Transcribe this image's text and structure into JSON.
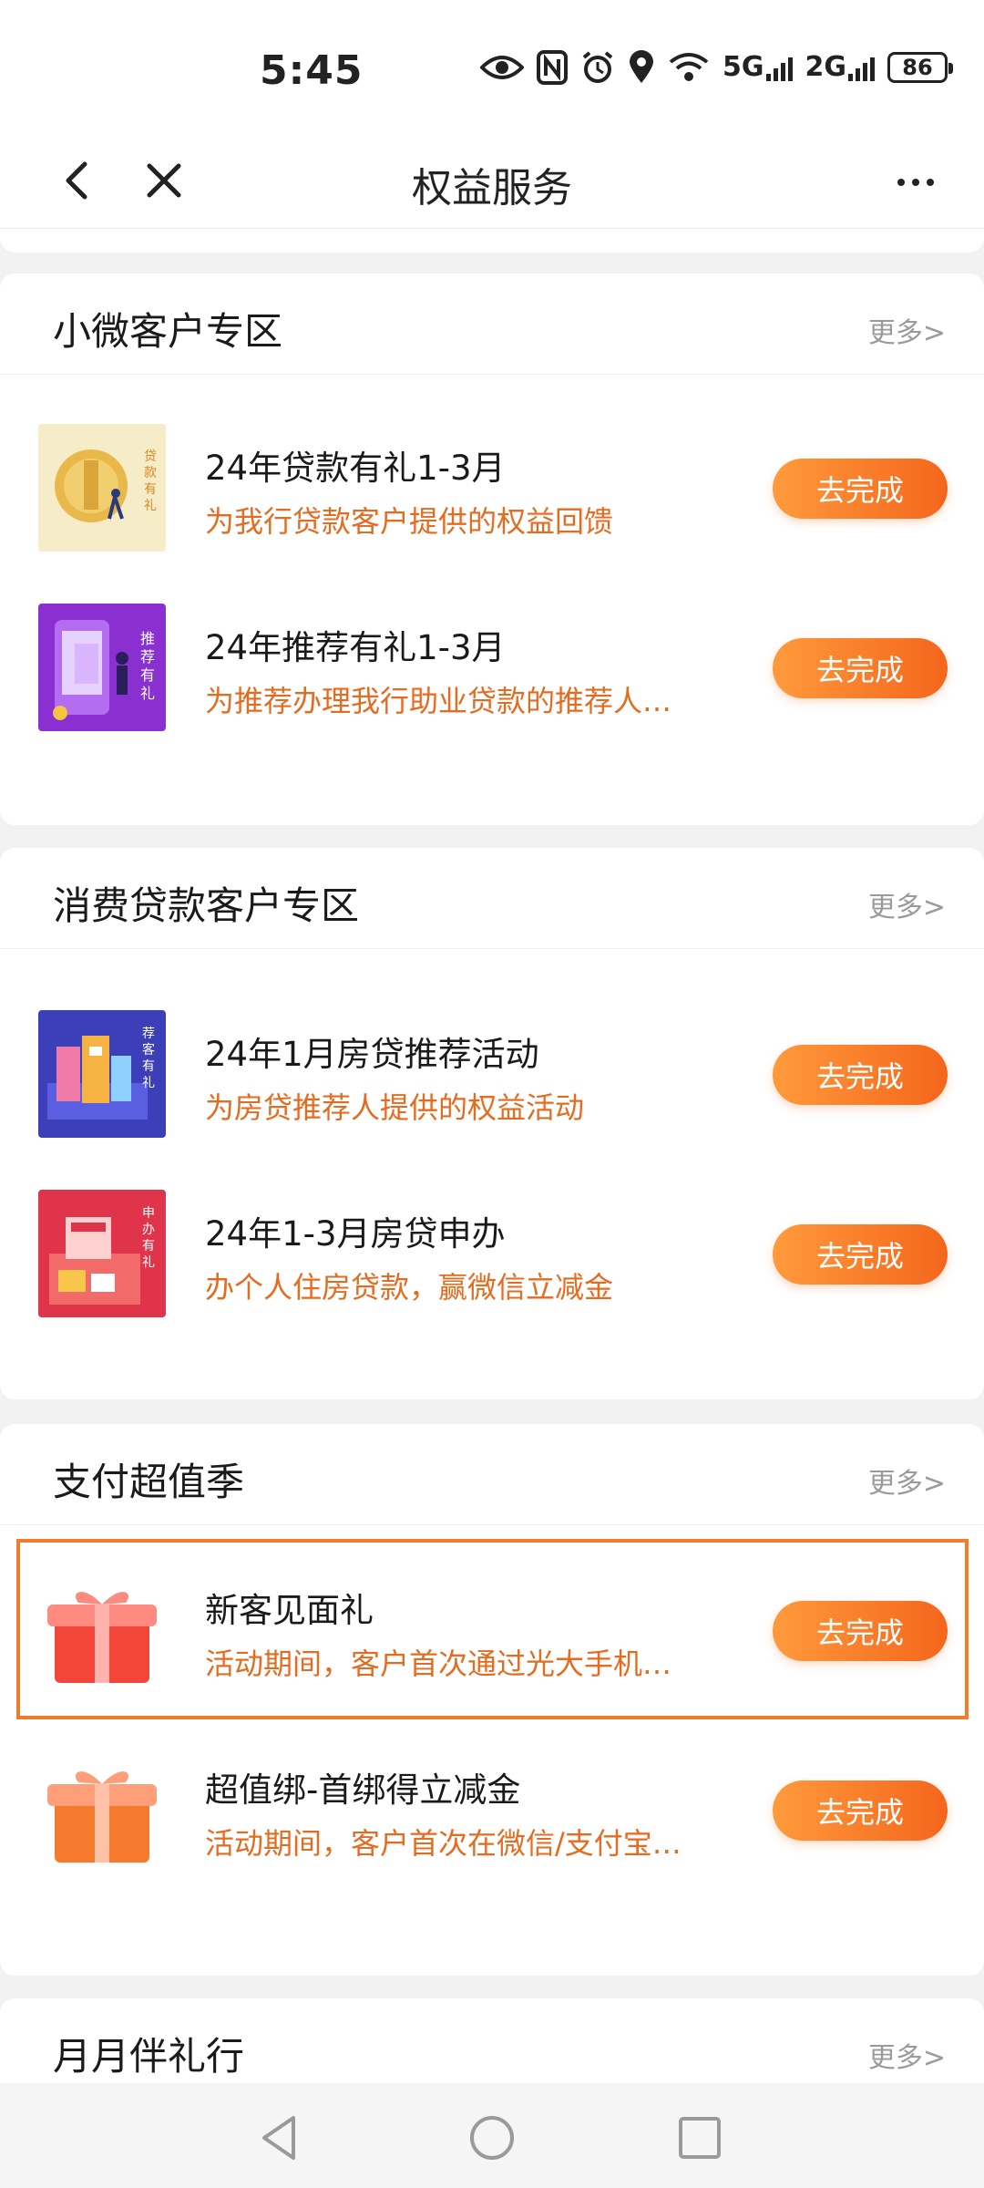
{
  "status_bar": {
    "time": "5:45",
    "network_1": "5G",
    "network_2": "2G",
    "battery": "86"
  },
  "nav": {
    "title": "权益服务"
  },
  "sections": [
    {
      "title": "小微客户专区",
      "more": "更多>",
      "items": [
        {
          "title": "24年贷款有礼1-3月",
          "desc": "为我行贷款客户提供的权益回馈",
          "button": "去完成",
          "thumb_text": "贷款有礼"
        },
        {
          "title": "24年推荐有礼1-3月",
          "desc": "为推荐办理我行助业贷款的推荐人…",
          "button": "去完成",
          "thumb_text": "推荐有礼"
        }
      ]
    },
    {
      "title": "消费贷款客户专区",
      "more": "更多>",
      "items": [
        {
          "title": "24年1月房贷推荐活动",
          "desc": "为房贷推荐人提供的权益活动",
          "button": "去完成",
          "thumb_text": "荐客有礼"
        },
        {
          "title": "24年1-3月房贷申办",
          "desc": "办个人住房贷款，赢微信立减金",
          "button": "去完成",
          "thumb_text": "申办有礼"
        }
      ]
    },
    {
      "title": "支付超值季",
      "more": "更多>",
      "items": [
        {
          "title": "新客见面礼",
          "desc": "活动期间，客户首次通过光大手机…",
          "button": "去完成"
        },
        {
          "title": "超值绑-首绑得立减金",
          "desc": "活动期间，客户首次在微信/支付宝…",
          "button": "去完成"
        }
      ]
    },
    {
      "title": "月月伴礼行",
      "more": "更多>"
    }
  ],
  "colors": {
    "accent": "#f4661c",
    "desc_text": "#e56b1f",
    "highlight_border": "#ef7d2b"
  }
}
